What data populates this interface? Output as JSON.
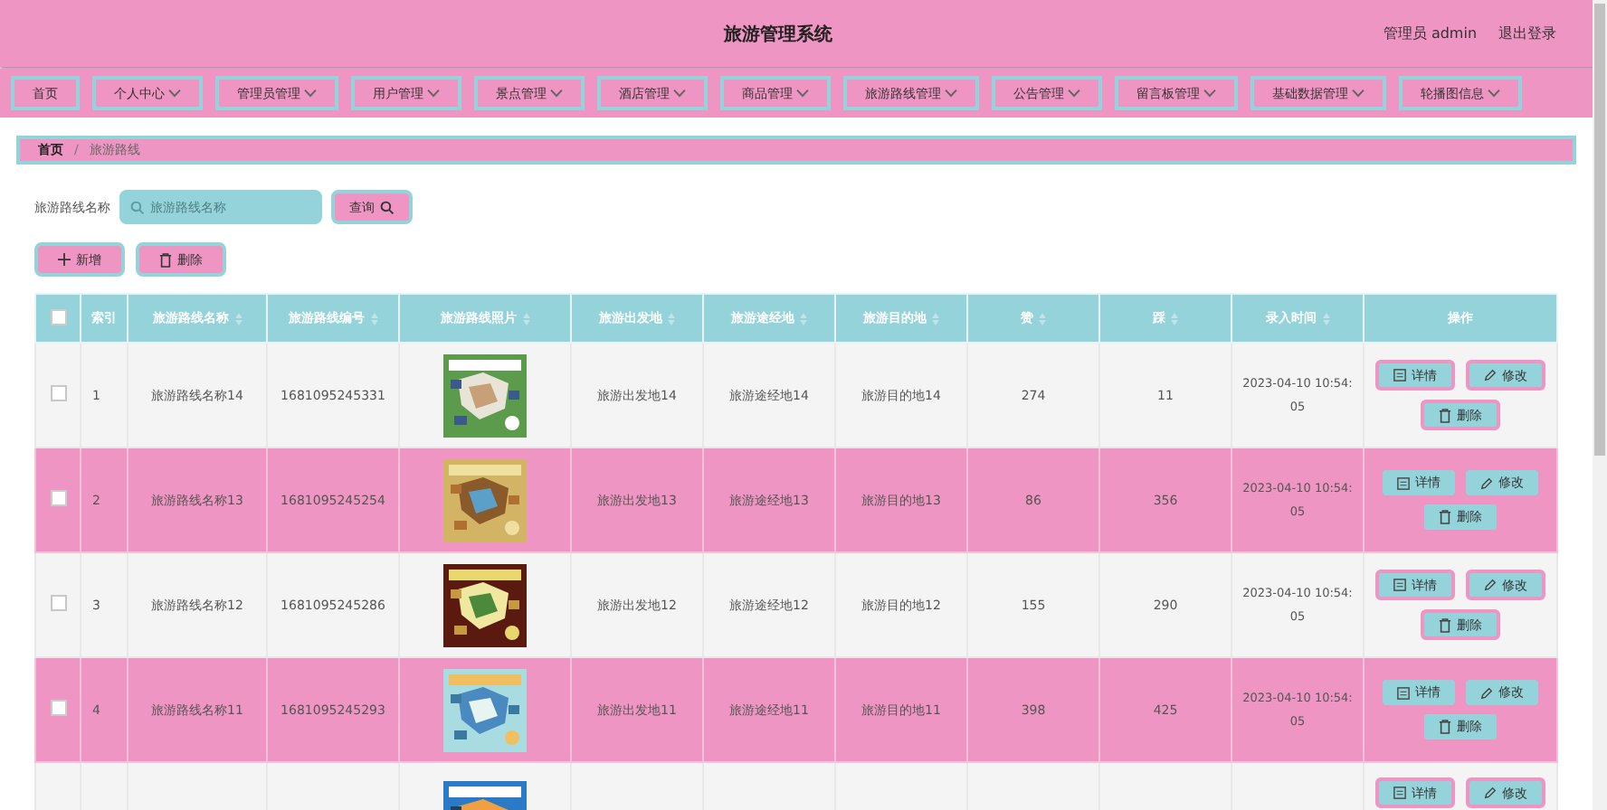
{
  "header": {
    "title": "旅游管理系统",
    "user": "管理员 admin",
    "logout": "退出登录"
  },
  "nav": [
    {
      "label": "首页",
      "dropdown": false
    },
    {
      "label": "个人中心",
      "dropdown": true
    },
    {
      "label": "管理员管理",
      "dropdown": true
    },
    {
      "label": "用户管理",
      "dropdown": true
    },
    {
      "label": "景点管理",
      "dropdown": true
    },
    {
      "label": "酒店管理",
      "dropdown": true
    },
    {
      "label": "商品管理",
      "dropdown": true
    },
    {
      "label": "旅游路线管理",
      "dropdown": true
    },
    {
      "label": "公告管理",
      "dropdown": true
    },
    {
      "label": "留言板管理",
      "dropdown": true
    },
    {
      "label": "基础数据管理",
      "dropdown": true
    },
    {
      "label": "轮播图信息",
      "dropdown": true
    }
  ],
  "breadcrumb": {
    "separator": "/",
    "items": [
      "首页",
      "旅游路线"
    ]
  },
  "search": {
    "label": "旅游路线名称",
    "placeholder": "旅游路线名称",
    "button": "查询"
  },
  "actions": {
    "add": "新增",
    "delete": "删除"
  },
  "table": {
    "select_all": {
      "checked": false
    },
    "columns": [
      {
        "label": "索引",
        "sortable": false
      },
      {
        "label": "旅游路线名称",
        "sortable": true
      },
      {
        "label": "旅游路线编号",
        "sortable": true
      },
      {
        "label": "旅游路线照片",
        "sortable": true
      },
      {
        "label": "旅游出发地",
        "sortable": true
      },
      {
        "label": "旅游途经地",
        "sortable": true
      },
      {
        "label": "旅游目的地",
        "sortable": true
      },
      {
        "label": "赞",
        "sortable": true
      },
      {
        "label": "踩",
        "sortable": true
      },
      {
        "label": "录入时间",
        "sortable": true
      },
      {
        "label": "操作",
        "sortable": false
      }
    ],
    "rows": [
      {
        "checked": false,
        "index": "1",
        "name": "旅游路线名称14",
        "code": "1681095245331",
        "photo": {
          "kind": "picture"
        },
        "origin": "旅游出发地14",
        "via": "旅游途经地14",
        "destination": "旅游目的地14",
        "likes": "274",
        "dislikes": "11",
        "time": "2023-04-10 10:54:05",
        "buttons": [
          "详情",
          "修改",
          "删除"
        ]
      },
      {
        "checked": false,
        "index": "2",
        "name": "旅游路线名称13",
        "code": "1681095245254",
        "photo": {
          "kind": "picture"
        },
        "origin": "旅游出发地13",
        "via": "旅游途经地13",
        "destination": "旅游目的地13",
        "likes": "86",
        "dislikes": "356",
        "time": "2023-04-10 10:54:05",
        "buttons": [
          "详情",
          "修改",
          "删除"
        ]
      },
      {
        "checked": false,
        "index": "3",
        "name": "旅游路线名称12",
        "code": "1681095245286",
        "photo": {
          "kind": "picture"
        },
        "origin": "旅游出发地12",
        "via": "旅游途经地12",
        "destination": "旅游目的地12",
        "likes": "155",
        "dislikes": "290",
        "time": "2023-04-10 10:54:05",
        "buttons": [
          "详情",
          "修改",
          "删除"
        ]
      },
      {
        "checked": false,
        "index": "4",
        "name": "旅游路线名称11",
        "code": "1681095245293",
        "photo": {
          "kind": "picture"
        },
        "origin": "旅游出发地11",
        "via": "旅游途经地11",
        "destination": "旅游目的地11",
        "likes": "398",
        "dislikes": "425",
        "time": "2023-04-10 10:54:05",
        "buttons": [
          "详情",
          "修改",
          "删除"
        ]
      },
      {
        "photo": {
          "kind": "picture"
        },
        "buttons": [
          "详情",
          "修改"
        ]
      }
    ]
  }
}
